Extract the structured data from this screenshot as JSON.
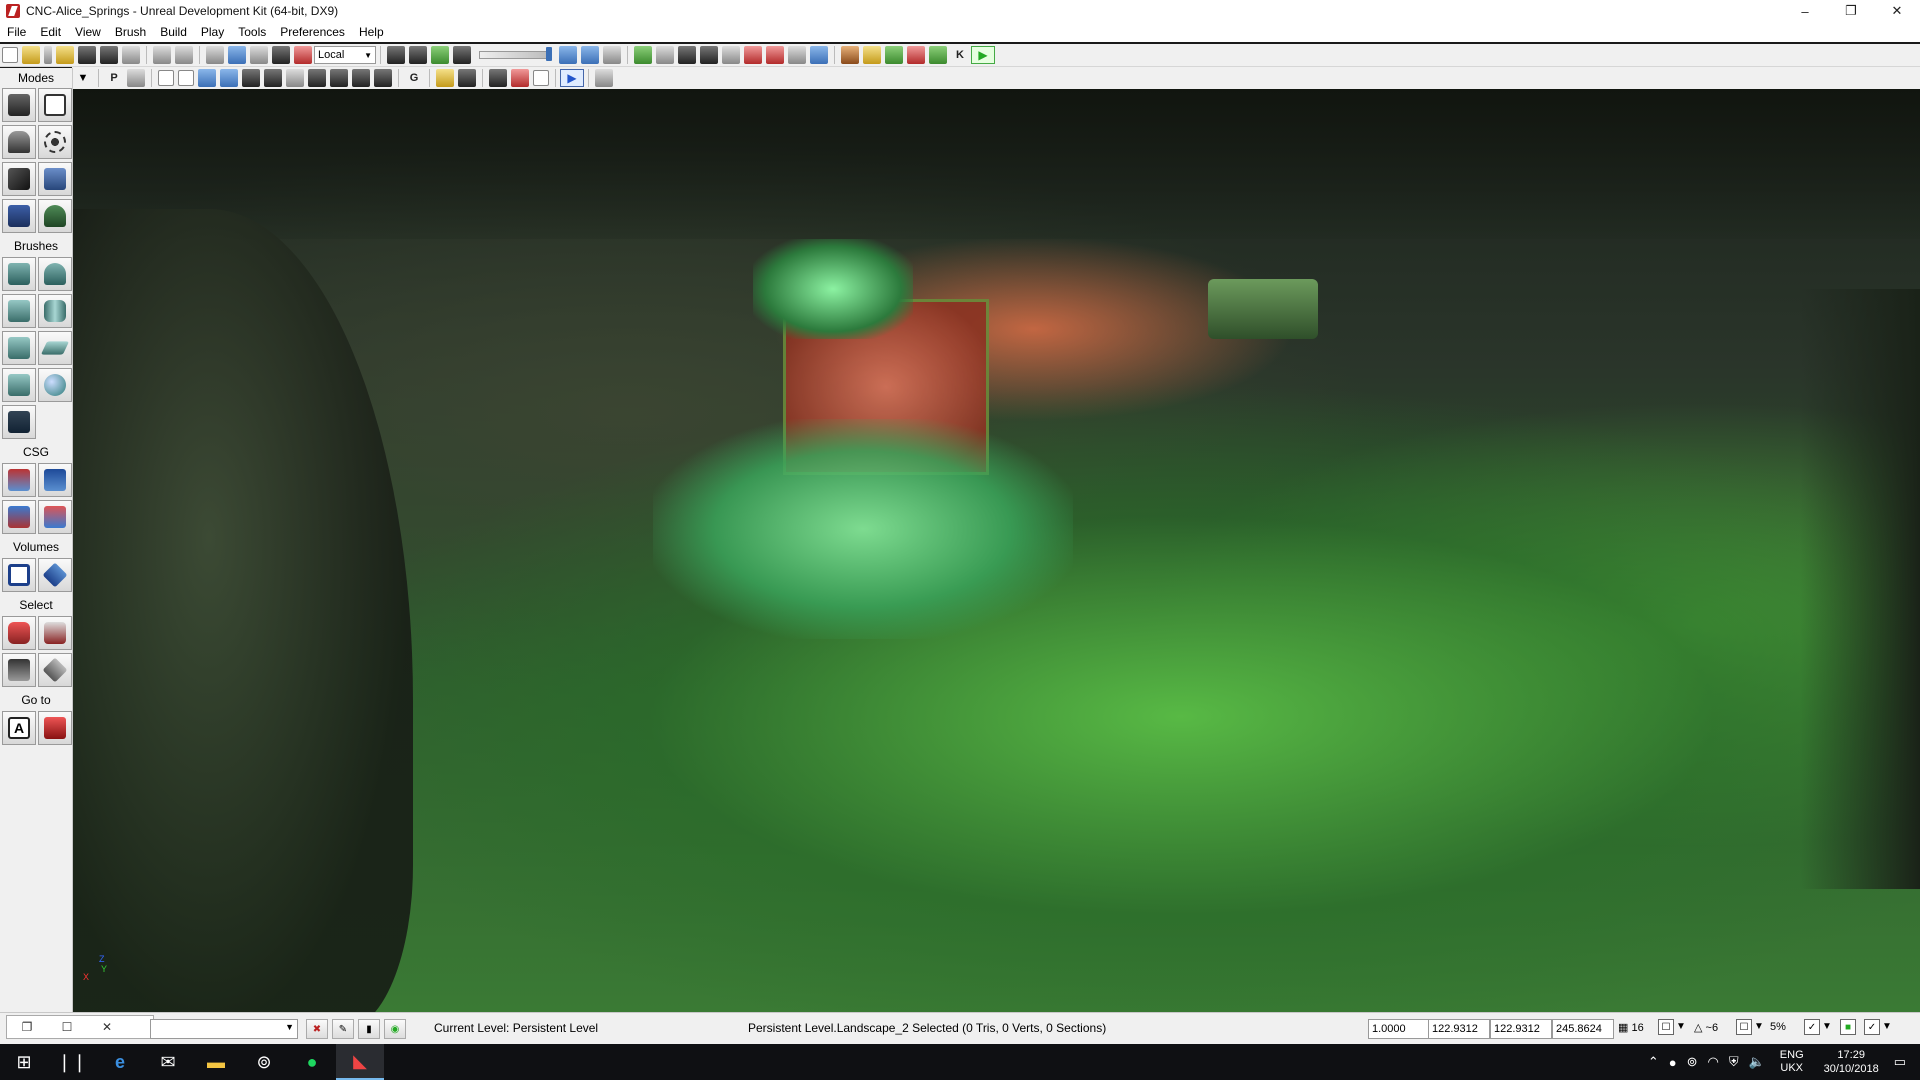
{
  "window": {
    "title": "CNC-Alice_Springs - Unreal Development Kit (64-bit, DX9)",
    "minimize": "–",
    "maximize": "❐",
    "close": "✕"
  },
  "menu": [
    "File",
    "Edit",
    "View",
    "Brush",
    "Build",
    "Play",
    "Tools",
    "Preferences",
    "Help"
  ],
  "toolbar": {
    "coord_system": "Local",
    "p_label": "P",
    "g_label": "G",
    "k_label": "K"
  },
  "modes": {
    "header": "Modes",
    "brushes_label": "Brushes",
    "csg_label": "CSG",
    "volumes_label": "Volumes",
    "select_label": "Select",
    "goto_label": "Go to",
    "goto_a": "A"
  },
  "status": {
    "current_level_label": "Current Level:",
    "current_level_value": "Persistent Level",
    "selection": "Persistent Level.Landscape_2 Selected (0 Tris, 0 Verts, 0 Sections)",
    "scale": "1.0000",
    "drag_x": "122.9312",
    "drag_y": "122.9312",
    "drag_z": "245.8624",
    "grid": "16",
    "rot_snap": "~6",
    "scale_snap": "5%"
  },
  "taskbar": {
    "lang_top": "ENG",
    "lang_bottom": "UKX",
    "time": "17:29",
    "date": "30/10/2018"
  },
  "viewport": {
    "axis_x": "X",
    "axis_y": "Y",
    "axis_z": "Z"
  }
}
